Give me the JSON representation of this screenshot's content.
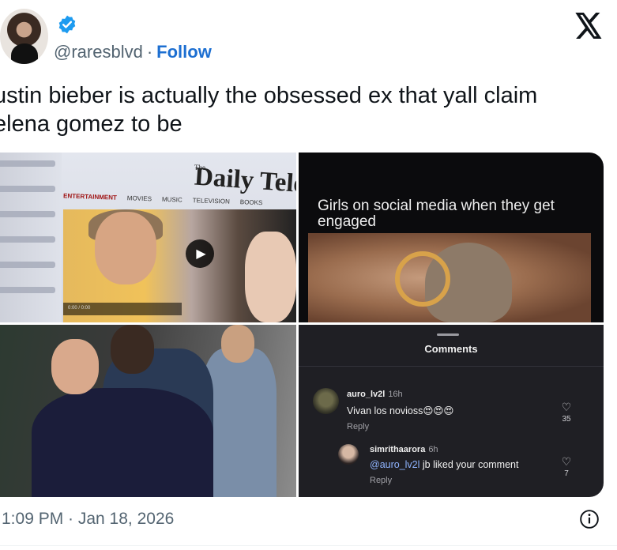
{
  "author": {
    "handle": "@raresblvd",
    "separator": "·",
    "follow_label": "Follow"
  },
  "tweet": {
    "line1": "ustin bieber is actually the obsessed ex that yall claim",
    "line2": "elena gomez to be"
  },
  "media": {
    "image1": {
      "paper_the": "The",
      "paper_name": "Daily Teleg",
      "nav": [
        "ENTERTAINMENT",
        "MOVIES",
        "MUSIC",
        "TELEVISION",
        "BOOKS"
      ],
      "player_time": "0:00 / 0:00"
    },
    "image2": {
      "caption": "Girls on social media when they get engaged"
    },
    "image4": {
      "panel_title": "Comments",
      "comments": [
        {
          "user": "auro_lv2l",
          "time": "16h",
          "text": "Vivan los novioss😍😍😍",
          "reply": "Reply",
          "likes": "35"
        },
        {
          "user": "simrithaarora",
          "time": "6h",
          "mention": "@auro_lv2l",
          "text": " jb liked your comment",
          "reply": "Reply",
          "likes": "7"
        }
      ]
    }
  },
  "footer": {
    "timestamp": "1:09 PM · Jan 18, 2026"
  },
  "colors": {
    "link": "#1d6fd1",
    "muted": "#536471",
    "verified": "#1d9bf0"
  },
  "icons": [
    "verified-badge-icon",
    "x-logo-icon",
    "play-icon",
    "heart-icon",
    "info-icon"
  ]
}
